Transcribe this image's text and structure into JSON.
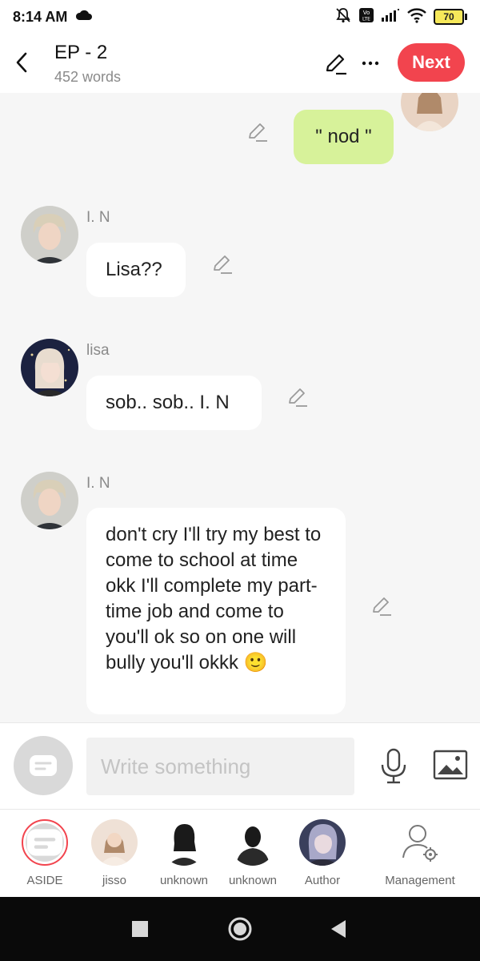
{
  "status_bar": {
    "time": "8:14 AM",
    "battery": "70"
  },
  "header": {
    "title": "EP - 2",
    "word_count": "452 words",
    "next_label": "Next"
  },
  "messages": [
    {
      "sender": "",
      "text": "\" nod \"",
      "mine": true
    },
    {
      "sender": "I. N",
      "text": "Lisa??"
    },
    {
      "sender": "lisa",
      "text": "sob.. sob.. I. N"
    },
    {
      "sender": "I. N",
      "text": "don't cry I'll try my best to come to school at time okk I'll complete my part-time job and come to you'll ok so on one will bully you'll okkk 🙂"
    }
  ],
  "composer": {
    "placeholder": "Write something"
  },
  "characters": [
    {
      "label": "ASIDE"
    },
    {
      "label": "jisso"
    },
    {
      "label": "unknown"
    },
    {
      "label": "unknown"
    },
    {
      "label": "Author"
    },
    {
      "label": "Management"
    }
  ],
  "colors": {
    "accent": "#f2444e",
    "my_bubble": "#d7f29a",
    "background": "#f6f6f6"
  }
}
